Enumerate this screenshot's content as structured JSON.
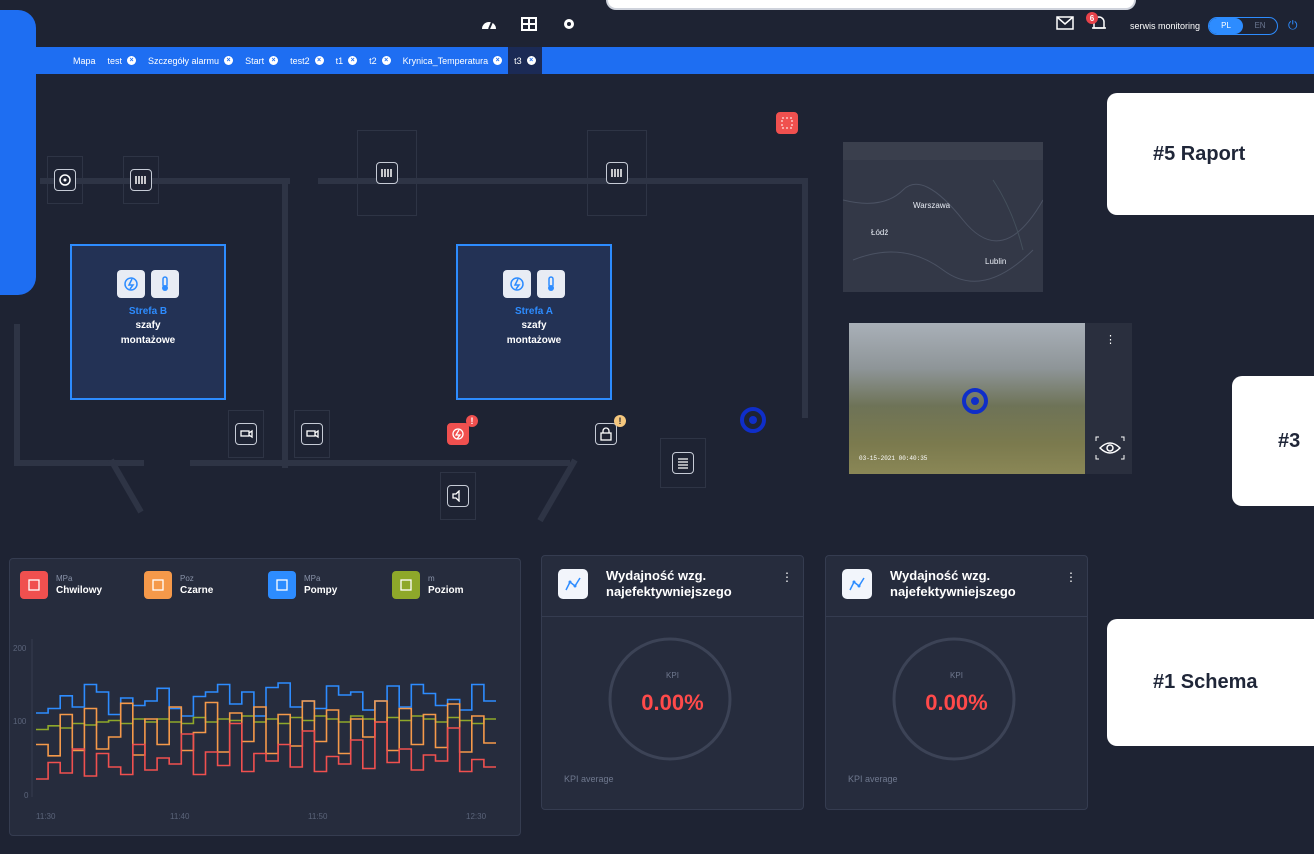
{
  "header": {
    "nav_icons": [
      "dashboard-icon",
      "schema-icon",
      "settings-icon"
    ],
    "notifications_count": "6",
    "user_name": "serwis monitoring",
    "lang": {
      "active": "PL",
      "inactive": "EN"
    }
  },
  "tabs": [
    {
      "label": "Mapa",
      "closable": false
    },
    {
      "label": "test",
      "closable": true
    },
    {
      "label": "Szczegóły alarmu",
      "closable": true
    },
    {
      "label": "Start",
      "closable": true
    },
    {
      "label": "test2",
      "closable": true
    },
    {
      "label": "t1",
      "closable": true
    },
    {
      "label": "t2",
      "closable": true
    },
    {
      "label": "Krynica_Temperatura",
      "closable": true
    },
    {
      "label": "t3",
      "closable": true,
      "active": true
    }
  ],
  "zones": [
    {
      "name": "Strefa B",
      "desc_1": "szafy",
      "desc_2": "montażowe"
    },
    {
      "name": "Strefa A",
      "desc_1": "szafy",
      "desc_2": "montażowe"
    }
  ],
  "map": {
    "cities": [
      "Warszawa",
      "Łódź",
      "Lublin"
    ]
  },
  "camera": {
    "timestamp": "03-15-2021 00:40:35"
  },
  "callouts": {
    "c5": "#5 Raport",
    "c3": "#3",
    "c1": "#1 Schema"
  },
  "chart_legend": [
    {
      "unit": "MPa",
      "name": "Chwilowy",
      "color": "#f0504f"
    },
    {
      "unit": "Poz",
      "name": "Czarne",
      "color": "#f5994a"
    },
    {
      "unit": "MPa",
      "name": "Pompy",
      "color": "#2d8cff"
    },
    {
      "unit": "m",
      "name": "Poziom",
      "color": "#8ea82a"
    }
  ],
  "chart_data": {
    "type": "line",
    "x_ticks": [
      "11:30",
      "11:40",
      "11:50",
      "12:30"
    ],
    "y_ticks": [
      "200",
      "100",
      "0"
    ],
    "ylim": [
      0,
      200
    ],
    "series": [
      {
        "name": "Pompy",
        "color": "#2d8cff",
        "values": [
          112,
          118,
          135,
          120,
          150,
          140,
          110,
          132,
          122,
          128,
          145,
          118,
          108,
          134,
          140,
          150,
          124,
          140,
          108,
          146,
          152,
          120,
          128,
          118,
          148,
          136,
          140,
          116,
          128,
          148,
          120,
          150,
          138,
          122,
          130,
          116,
          150,
          128
        ]
      },
      {
        "name": "Poziom",
        "color": "#8ea82a",
        "values": [
          90,
          95,
          92,
          98,
          96,
          100,
          102,
          98,
          104,
          100,
          104,
          100,
          98,
          106,
          100,
          104,
          102,
          108,
          100,
          104,
          98,
          106,
          102,
          108,
          104,
          100,
          108,
          104,
          100,
          106,
          102,
          108,
          104,
          100,
          106,
          102,
          98,
          104
        ]
      },
      {
        "name": "Czarne",
        "color": "#f5994a",
        "values": [
          70,
          55,
          110,
          62,
          118,
          64,
          80,
          125,
          56,
          104,
          70,
          120,
          62,
          86,
          126,
          60,
          112,
          74,
          120,
          58,
          110,
          68,
          128,
          74,
          116,
          58,
          104,
          80,
          128,
          62,
          118,
          70,
          110,
          66,
          124,
          60,
          108,
          72
        ]
      },
      {
        "name": "Chwilowy",
        "color": "#f0504f",
        "values": [
          24,
          46,
          32,
          64,
          28,
          58,
          40,
          30,
          70,
          36,
          52,
          44,
          84,
          30,
          60,
          42,
          98,
          34,
          58,
          48,
          70,
          40,
          88,
          34,
          54,
          44,
          76,
          38,
          100,
          46,
          64,
          36,
          56,
          48,
          92,
          34,
          50,
          40
        ]
      }
    ]
  },
  "kpi_cards": [
    {
      "title_1": "Wydajność wzg.",
      "title_2": "najefektywniejszego",
      "label": "KPI",
      "value": "0.00%",
      "footer": "KPI average"
    },
    {
      "title_1": "Wydajność wzg.",
      "title_2": "najefektywniejszego",
      "label": "KPI",
      "value": "0.00%",
      "footer": "KPI average"
    }
  ],
  "colors": {
    "accent": "#1e6ef2",
    "background": "#1e2333",
    "alert": "#f0504f"
  }
}
